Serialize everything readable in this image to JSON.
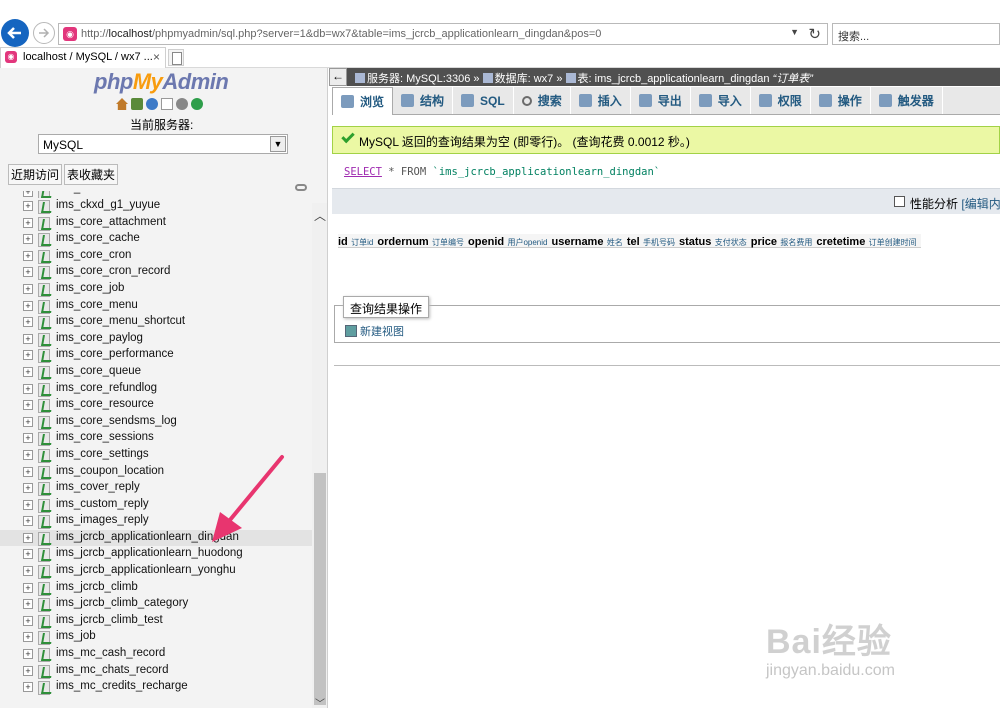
{
  "browser": {
    "url_prefix": "http://",
    "url_host": "localhost",
    "url_rest": "/phpmyadmin/sql.php?server=1&db=wx7&table=ims_jcrcb_applicationlearn_dingdan&pos=0",
    "search_placeholder": "搜索...",
    "tab_title": "localhost / MySQL / wx7 ...",
    "tab_close": "×"
  },
  "nav": {
    "logo_php": "php",
    "logo_my": "My",
    "logo_admin": "Admin",
    "current_server_label": "当前服务器:",
    "server_value": "MySQL",
    "recent_tab": "近期访问",
    "favorites_tab": "表收藏夹",
    "tables": [
      "ims_business",
      "ims_ckxd_g1_yuyue",
      "ims_core_attachment",
      "ims_core_cache",
      "ims_core_cron",
      "ims_core_cron_record",
      "ims_core_job",
      "ims_core_menu",
      "ims_core_menu_shortcut",
      "ims_core_paylog",
      "ims_core_performance",
      "ims_core_queue",
      "ims_core_refundlog",
      "ims_core_resource",
      "ims_core_sendsms_log",
      "ims_core_sessions",
      "ims_core_settings",
      "ims_coupon_location",
      "ims_cover_reply",
      "ims_custom_reply",
      "ims_images_reply",
      "ims_jcrcb_applicationlearn_dingdan",
      "ims_jcrcb_applicationlearn_huodong",
      "ims_jcrcb_applicationlearn_yonghu",
      "ims_jcrcb_climb",
      "ims_jcrcb_climb_category",
      "ims_jcrcb_climb_test",
      "ims_job",
      "ims_mc_cash_record",
      "ims_mc_chats_record",
      "ims_mc_credits_recharge"
    ],
    "selected_table": "ims_jcrcb_applicationlearn_dingdan"
  },
  "breadcrumb": {
    "server": "服务器: MySQL:3306",
    "sep": "»",
    "database": "数据库: wx7",
    "table": "表: ims_jcrcb_applicationlearn_dingdan",
    "comment": "“订单表”"
  },
  "menu": [
    {
      "label": "浏览"
    },
    {
      "label": "结构"
    },
    {
      "label": "SQL"
    },
    {
      "label": "搜索"
    },
    {
      "label": "插入"
    },
    {
      "label": "导出"
    },
    {
      "label": "导入"
    },
    {
      "label": "权限"
    },
    {
      "label": "操作"
    },
    {
      "label": "触发器"
    }
  ],
  "message": "MySQL 返回的查询结果为空 (即零行)。 (查询花费 0.0012 秒。)",
  "sql": {
    "select": "SELECT",
    "star_from": "* FROM",
    "table": "`ims_jcrcb_applicationlearn_dingdan`"
  },
  "profiling": {
    "label": "性能分析",
    "edit": "[编辑内嵌"
  },
  "columns": [
    {
      "name": "id",
      "comment": "订单id"
    },
    {
      "name": "ordernum",
      "comment": "订单编号"
    },
    {
      "name": "openid",
      "comment": "用户openid"
    },
    {
      "name": "username",
      "comment": "姓名"
    },
    {
      "name": "tel",
      "comment": "手机号码"
    },
    {
      "name": "status",
      "comment": "支付状态"
    },
    {
      "name": "price",
      "comment": "报名费用"
    },
    {
      "name": "cretetime",
      "comment": "订单创建时间"
    }
  ],
  "ops": {
    "legend": "查询结果操作",
    "create_view": "新建视图"
  },
  "watermark": {
    "brand": "Bai经验",
    "site": "jingyan.baidu.com"
  },
  "colors": {
    "success_bg": "#ebf8a4",
    "link": "#235a81",
    "annotation_arrow": "#e8356f"
  }
}
